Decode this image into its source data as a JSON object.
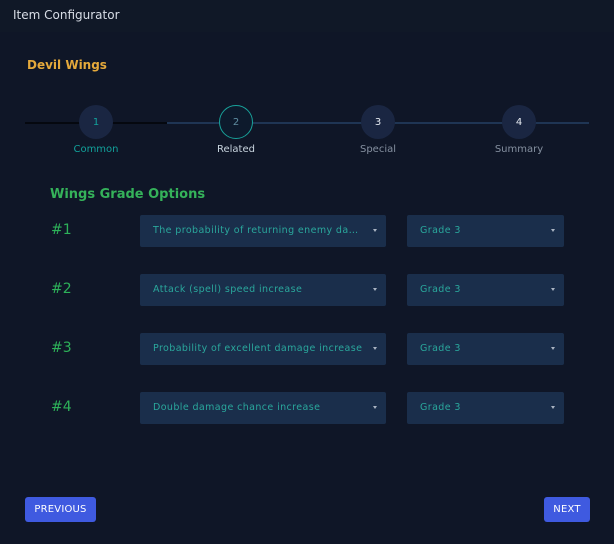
{
  "app": {
    "title": "Item Configurator"
  },
  "item": {
    "name": "Devil Wings"
  },
  "stepper": {
    "active_index": 1,
    "steps": [
      {
        "number": "1",
        "label": "Common",
        "state": "completed"
      },
      {
        "number": "2",
        "label": "Related",
        "state": "active"
      },
      {
        "number": "3",
        "label": "Special",
        "state": "pending"
      },
      {
        "number": "4",
        "label": "Summary",
        "state": "pending"
      }
    ]
  },
  "section": {
    "title": "Wings Grade Options"
  },
  "options": [
    {
      "index": "#1",
      "option": "The probability of returning enemy damage",
      "grade": "Grade 3"
    },
    {
      "index": "#2",
      "option": "Attack (spell) speed increase",
      "grade": "Grade 3"
    },
    {
      "index": "#3",
      "option": "Probability of excellent damage increase",
      "grade": "Grade 3"
    },
    {
      "index": "#4",
      "option": "Double damage chance increase",
      "grade": "Grade 3"
    }
  ],
  "buttons": {
    "previous": "PREVIOUS",
    "next": "NEXT"
  },
  "colors": {
    "background": "#0f1627",
    "accent_orange": "#e5a93b",
    "accent_green": "#35b25a",
    "accent_teal": "#12a19b",
    "button_blue": "#3f5ae0",
    "select_bg": "#1a2e4b"
  }
}
